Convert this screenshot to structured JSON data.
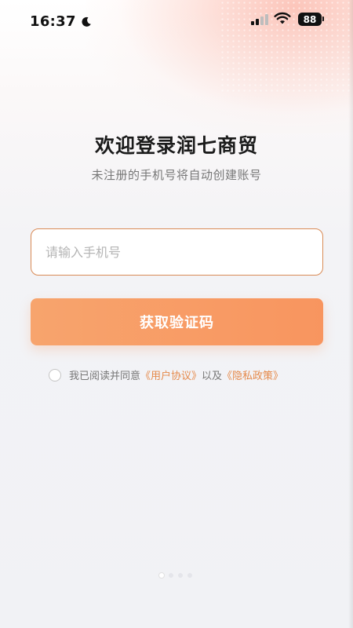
{
  "status_bar": {
    "time": "16:37",
    "battery": "88",
    "icons": [
      "moon-icon",
      "cellular-signal-icon",
      "wifi-icon",
      "battery-icon"
    ]
  },
  "login": {
    "title": "欢迎登录润七商贸",
    "subtitle": "未注册的手机号将自动创建账号",
    "phone_input": {
      "value": "",
      "placeholder": "请输入手机号"
    },
    "submit_label": "获取验证码",
    "agreement": {
      "checked": false,
      "prefix": "我已阅读并同意",
      "user_agreement": "《用户协议》",
      "conjunction": "以及",
      "privacy_policy": "《隐私政策》"
    }
  },
  "colors": {
    "accent": "#f8955f",
    "link": "#e58a4c",
    "input_border": "#d98a55",
    "background": "#f1f2f5"
  }
}
